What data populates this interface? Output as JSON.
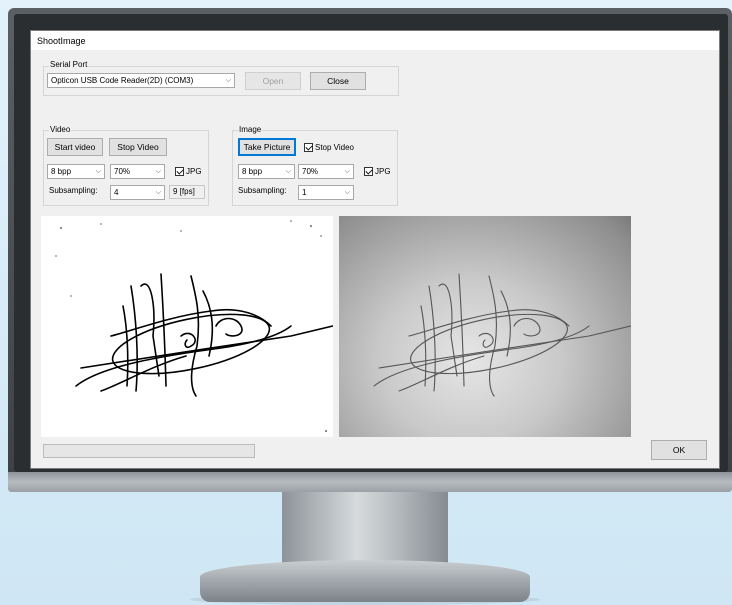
{
  "window": {
    "title": "ShootImage"
  },
  "serial_port": {
    "group_label": "Serial Port",
    "port_value": "Opticon USB Code Reader(2D) (COM3)",
    "open_label": "Open",
    "close_label": "Close"
  },
  "video": {
    "group_label": "Video",
    "start_label": "Start video",
    "stop_label": "Stop Video",
    "bpp_value": "8 bpp",
    "quality_value": "70%",
    "jpg_label": "JPG",
    "jpg_checked": true,
    "subsampling_label": "Subsampling:",
    "subsampling_value": "4",
    "fps_value": "9 [fps]"
  },
  "image": {
    "group_label": "Image",
    "take_label": "Take Picture",
    "stop_video_label": "Stop Video",
    "stop_video_checked": true,
    "bpp_value": "8 bpp",
    "quality_value": "70%",
    "jpg_label": "JPG",
    "jpg_checked": true,
    "subsampling_label": "Subsampling:",
    "subsampling_value": "1"
  },
  "progress": {
    "value": 0
  },
  "ok_label": "OK",
  "icons": {
    "dropdown": "chevron-down-icon",
    "checkbox": "checkmark-icon"
  }
}
